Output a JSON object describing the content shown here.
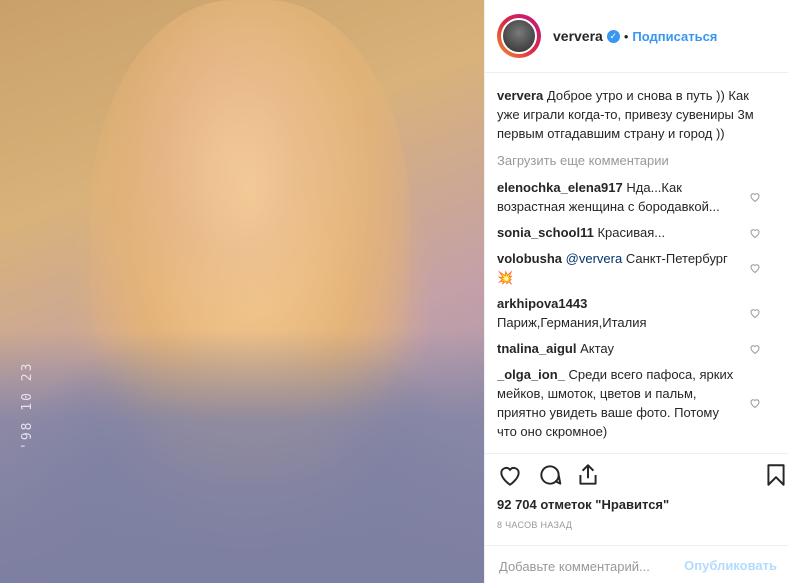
{
  "post": {
    "photo_stamp": "'98 10 23",
    "username": "ververa",
    "follow_label": "Подписаться",
    "caption_user": "ververa",
    "caption_text": "Доброе утро и снова в путь )) Как уже играли когда-то, привезу сувениры 3м первым отгадавшим страну и город ))",
    "load_more": "Загрузить еще комментарии",
    "comments": [
      {
        "user": "elenochka_elena917",
        "text": "Нда...Как возрастная женщина с бородавкой..."
      },
      {
        "user": "sonia_school11",
        "text": "Красивая..."
      },
      {
        "user": "volobusha",
        "mention": "@ververa",
        "text": "Санкт-Петербург 💥"
      },
      {
        "user": "arkhipova1443",
        "text": "Париж,Германия,Италия"
      },
      {
        "user": "tnalina_aigul",
        "text": "Актау"
      },
      {
        "user": "_olga_ion_",
        "text": "Среди всего пафоса, ярких мейков, шмоток, цветов и пальм, приятно увидеть ваше фото. Потому что оно скромное)"
      }
    ],
    "likes": "92 704 отметок \"Нравится\"",
    "time": "8 ЧАСОВ НАЗАД",
    "add_placeholder": "Добавьте комментарий...",
    "publish_label": "Опубликовать"
  },
  "icons": {
    "verified": "verified-badge-icon",
    "heart": "heart-icon",
    "comment": "comment-icon",
    "share": "share-icon",
    "bookmark": "bookmark-icon"
  },
  "colors": {
    "link": "#3897f0",
    "text": "#262626",
    "muted": "#999999"
  }
}
